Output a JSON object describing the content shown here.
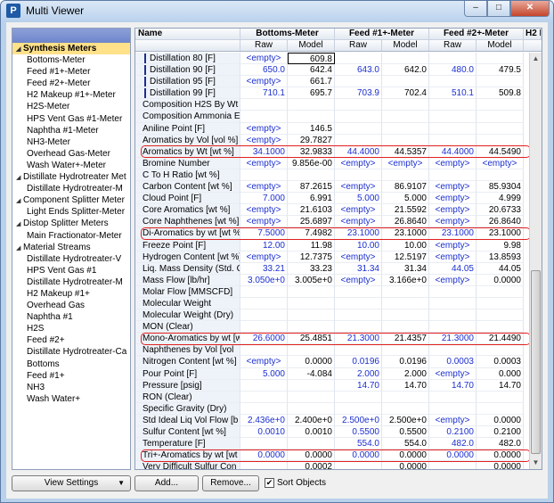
{
  "window": {
    "title": "Multi Viewer",
    "icon_letter": "P",
    "buttons": {
      "minimize": "–",
      "maximize": "□",
      "close": "✕"
    }
  },
  "tree": {
    "items": [
      {
        "label": "Synthesis Meters",
        "level": 0,
        "expander": "◢",
        "selected": true
      },
      {
        "label": "Bottoms-Meter",
        "level": 1
      },
      {
        "label": "Feed #1+-Meter",
        "level": 1
      },
      {
        "label": "Feed #2+-Meter",
        "level": 1
      },
      {
        "label": "H2 Makeup #1+-Meter",
        "level": 1
      },
      {
        "label": "H2S-Meter",
        "level": 1
      },
      {
        "label": "HPS Vent Gas #1-Meter",
        "level": 1
      },
      {
        "label": "Naphtha #1-Meter",
        "level": 1
      },
      {
        "label": "NH3-Meter",
        "level": 1
      },
      {
        "label": "Overhead Gas-Meter",
        "level": 1
      },
      {
        "label": "Wash Water+-Meter",
        "level": 1
      },
      {
        "label": "Distillate Hydrotreater Met",
        "level": 0,
        "expander": "◢"
      },
      {
        "label": "Distillate Hydrotreater-M",
        "level": 1
      },
      {
        "label": "Component Splitter Meter",
        "level": 0,
        "expander": "◢"
      },
      {
        "label": "Light Ends Splitter-Meter",
        "level": 1
      },
      {
        "label": "Distop Splitter Meters",
        "level": 0,
        "expander": "◢"
      },
      {
        "label": "Main Fractionator-Meter",
        "level": 1
      },
      {
        "label": "Material Streams",
        "level": 0,
        "expander": "◢"
      },
      {
        "label": "Distillate Hydrotreater-V",
        "level": 1
      },
      {
        "label": "HPS Vent Gas #1",
        "level": 1
      },
      {
        "label": "Distillate Hydrotreater-M",
        "level": 1
      },
      {
        "label": "H2 Makeup #1+",
        "level": 1
      },
      {
        "label": "Overhead Gas",
        "level": 1
      },
      {
        "label": "Naphtha #1",
        "level": 1
      },
      {
        "label": "H2S",
        "level": 1
      },
      {
        "label": "Feed #2+",
        "level": 1
      },
      {
        "label": "Distillate Hydrotreater-Ca",
        "level": 1
      },
      {
        "label": "Bottoms",
        "level": 1
      },
      {
        "label": "Feed #1+",
        "level": 1
      },
      {
        "label": "NH3",
        "level": 1
      },
      {
        "label": "Wash Water+",
        "level": 1
      }
    ]
  },
  "grid": {
    "name_header": "Name",
    "groups": [
      "Bottoms-Meter",
      "Feed #1+-Meter",
      "Feed #2+-Meter",
      "H2 I"
    ],
    "subheaders": [
      "Raw",
      "Model",
      "Raw",
      "Model",
      "Raw",
      "Model"
    ],
    "rows": [
      {
        "name": "Distillation 80 [F]",
        "vals": [
          "<empty>",
          "609.8",
          "",
          "",
          "",
          ""
        ],
        "indent": true
      },
      {
        "name": "Distillation 90 [F]",
        "vals": [
          "650.0",
          "642.4",
          "643.0",
          "642.0",
          "480.0",
          "479.5"
        ],
        "indent": true
      },
      {
        "name": "Distillation 95 [F]",
        "vals": [
          "<empty>",
          "661.7",
          "",
          "",
          "",
          ""
        ],
        "indent": true
      },
      {
        "name": "Distillation 99 [F]",
        "vals": [
          "710.1",
          "695.7",
          "703.9",
          "702.4",
          "510.1",
          "509.8"
        ],
        "indent": true
      },
      {
        "name": "Composition H2S By Wt",
        "vals": [
          "",
          "",
          "",
          "",
          "",
          ""
        ]
      },
      {
        "name": "Composition Ammonia E",
        "vals": [
          "",
          "",
          "",
          "",
          "",
          ""
        ]
      },
      {
        "name": "Aniline Point [F]",
        "vals": [
          "<empty>",
          "146.5",
          "",
          "",
          "",
          ""
        ]
      },
      {
        "name": "Aromatics by Vol [vol %]",
        "vals": [
          "<empty>",
          "29.7827",
          "",
          "",
          "",
          ""
        ]
      },
      {
        "name": "Aromatics by Wt [wt %]",
        "vals": [
          "34.1000",
          "32.9833",
          "44.4000",
          "44.5357",
          "44.4000",
          "44.5490"
        ]
      },
      {
        "name": "Bromine Number",
        "vals": [
          "<empty>",
          "9.856e-00",
          "<empty>",
          "<empty>",
          "<empty>",
          "<empty>"
        ]
      },
      {
        "name": "C To H Ratio [wt %]",
        "vals": [
          "",
          "",
          "",
          "",
          "",
          ""
        ]
      },
      {
        "name": "Carbon Content [wt %]",
        "vals": [
          "<empty>",
          "87.2615",
          "<empty>",
          "86.9107",
          "<empty>",
          "85.9304"
        ]
      },
      {
        "name": "Cloud Point [F]",
        "vals": [
          "7.000",
          "6.991",
          "5.000",
          "5.000",
          "<empty>",
          "4.999"
        ]
      },
      {
        "name": "Core Aromatics [wt %]",
        "vals": [
          "<empty>",
          "21.6103",
          "<empty>",
          "21.5592",
          "<empty>",
          "20.6733"
        ]
      },
      {
        "name": "Core Naphthenes [wt %]",
        "vals": [
          "<empty>",
          "25.6897",
          "<empty>",
          "26.8640",
          "<empty>",
          "26.8640"
        ]
      },
      {
        "name": "Di-Aromatics by wt [wt %]",
        "vals": [
          "7.5000",
          "7.4982",
          "23.1000",
          "23.1000",
          "23.1000",
          "23.1000"
        ]
      },
      {
        "name": "Freeze Point [F]",
        "vals": [
          "12.00",
          "11.98",
          "10.00",
          "10.00",
          "<empty>",
          "9.98"
        ]
      },
      {
        "name": "Hydrogen Content [wt %]",
        "vals": [
          "<empty>",
          "12.7375",
          "<empty>",
          "12.5197",
          "<empty>",
          "13.8593"
        ]
      },
      {
        "name": "Liq. Mass Density (Std. C",
        "vals": [
          "33.21",
          "33.23",
          "31.34",
          "31.34",
          "44.05",
          "44.05"
        ]
      },
      {
        "name": "Mass Flow [lb/hr]",
        "vals": [
          "3.050e+0",
          "3.005e+0",
          "<empty>",
          "3.166e+0",
          "<empty>",
          "0.0000"
        ]
      },
      {
        "name": "Molar Flow [MMSCFD]",
        "vals": [
          "",
          "",
          "",
          "",
          "",
          ""
        ]
      },
      {
        "name": "Molecular Weight",
        "vals": [
          "",
          "",
          "",
          "",
          "",
          ""
        ]
      },
      {
        "name": "Molecular Weight (Dry)",
        "vals": [
          "",
          "",
          "",
          "",
          "",
          ""
        ]
      },
      {
        "name": "MON (Clear)",
        "vals": [
          "",
          "",
          "",
          "",
          "",
          ""
        ]
      },
      {
        "name": "Mono-Aromatics by wt [w",
        "vals": [
          "26.6000",
          "25.4851",
          "21.3000",
          "21.4357",
          "21.3000",
          "21.4490"
        ]
      },
      {
        "name": "Naphthenes by Vol [vol",
        "vals": [
          "",
          "",
          "",
          "",
          "",
          ""
        ]
      },
      {
        "name": "Nitrogen Content [wt %]",
        "vals": [
          "<empty>",
          "0.0000",
          "0.0196",
          "0.0196",
          "0.0003",
          "0.0003"
        ]
      },
      {
        "name": "Pour Point [F]",
        "vals": [
          "5.000",
          "-4.084",
          "2.000",
          "2.000",
          "<empty>",
          "0.000"
        ]
      },
      {
        "name": "Pressure [psig]",
        "vals": [
          "",
          "",
          "14.70",
          "14.70",
          "14.70",
          "14.70"
        ]
      },
      {
        "name": "RON (Clear)",
        "vals": [
          "",
          "",
          "",
          "",
          "",
          ""
        ]
      },
      {
        "name": "Specific Gravity (Dry)",
        "vals": [
          "",
          "",
          "",
          "",
          "",
          ""
        ]
      },
      {
        "name": "Std Ideal Liq Vol Flow [b",
        "vals": [
          "2.436e+0",
          "2.400e+0",
          "2.500e+0",
          "2.500e+0",
          "<empty>",
          "0.0000"
        ]
      },
      {
        "name": "Sulfur Content [wt %]",
        "vals": [
          "0.0010",
          "0.0010",
          "0.5500",
          "0.5500",
          "0.2100",
          "0.2100"
        ]
      },
      {
        "name": "Temperature [F]",
        "vals": [
          "",
          "",
          "554.0",
          "554.0",
          "482.0",
          "482.0"
        ]
      },
      {
        "name": "Tri+-Aromatics by wt [wt",
        "vals": [
          "0.0000",
          "0.0000",
          "0.0000",
          "0.0000",
          "0.0000",
          "0.0000"
        ]
      },
      {
        "name": "Very Difficult Sulfur Con",
        "vals": [
          "",
          "0.0002",
          "",
          "0.0000",
          "",
          "0.0000"
        ]
      }
    ],
    "highlighted_rows": [
      8,
      15,
      24,
      34
    ],
    "active_cell": {
      "row": 0,
      "col": 1
    }
  },
  "footer": {
    "view_settings": "View Settings",
    "add": "Add...",
    "remove": "Remove...",
    "sort_objects": "Sort Objects",
    "sort_checked": true
  },
  "colors": {
    "raw_text": "#1b2fd0",
    "highlight_border": "#e02020",
    "selected_tree_item": "#ffe18a",
    "tree_header": "#7a8fd2"
  }
}
